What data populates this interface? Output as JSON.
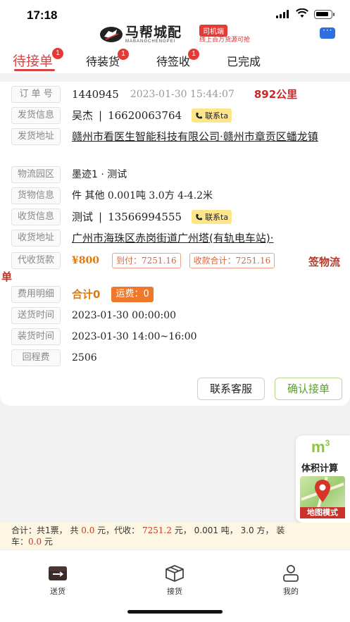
{
  "status_bar": {
    "time": "17:18"
  },
  "header": {
    "logo_text": "马帮城配",
    "logo_sub": "MABANGCHENGPEI",
    "driver_tag": "司机端",
    "driver_slogan": "线上百万货源可抢",
    "chat_icon": "chat-bubble-icon"
  },
  "tabs": [
    {
      "label": "待接单",
      "badge": "1",
      "active": true
    },
    {
      "label": "待装货",
      "badge": "1",
      "active": false
    },
    {
      "label": "待签收",
      "badge": "1",
      "active": false
    },
    {
      "label": "已完成",
      "badge": "",
      "active": false
    }
  ],
  "order": {
    "order_no_label": "订 单 号",
    "order_no": "1440945",
    "order_time": "2023-01-30 15:44:07",
    "distance": "892公里",
    "sender_label": "发货信息",
    "sender_name": "吴杰",
    "sender_phone": "16620063764",
    "contact_label": "联系ta",
    "sender_addr_label": "发货地址",
    "sender_addr": "赣州市看医生智能科技有限公司·赣州市章贡区蟠龙镇",
    "park_label": "物流园区",
    "park": "墨迹1 · 测试",
    "goods_label": "货物信息",
    "goods": "件 其他 0.001吨 3.0方 4-4.2米",
    "receiver_label": "收货信息",
    "receiver_name": "测试",
    "receiver_phone": "13566994555",
    "receiver_addr_label": "收货地址",
    "receiver_addr": "广州市海珠区赤岗街道广州塔(有轨电车站)·",
    "cod_label": "代收货款",
    "cod_amount": "¥800",
    "to_pay_label": "到付：",
    "to_pay": "7251.16",
    "collect_total_label": "收款合计：",
    "collect_total": "7251.16",
    "sign_label_line1": "签物流",
    "sign_label_line2": "单",
    "fee_label": "费用明细",
    "fee_total": "合计0",
    "freight": "运费：0",
    "delivery_time_label": "送货时间",
    "delivery_time": "2023-01-30 00:00:00",
    "loading_time_label": "装货时间",
    "loading_time": "2023-01-30 14:00~16:00",
    "return_fee_label": "回程费",
    "return_fee": "2506"
  },
  "actions": {
    "contact_service": "联系客服",
    "confirm_order": "确认接单"
  },
  "float_panel": {
    "m3": "m",
    "m3_sup": "3",
    "volume_calc": "体积计算",
    "map_mode": "地图模式"
  },
  "summary": {
    "prefix": "合计：共1票，  共 ",
    "amount": "0.0",
    "mid1": " 元，代收：  ",
    "cod": "7251.2",
    "mid2": " 元，  0.001 吨，  3.0 方，  装",
    "line2_prefix": "车：",
    "loading": "0.0",
    "line2_suffix": " 元"
  },
  "bottom_nav": [
    {
      "label": "送货",
      "icon": "delivery-box-icon"
    },
    {
      "label": "接货",
      "icon": "package-icon"
    },
    {
      "label": "我的",
      "icon": "user-icon"
    }
  ],
  "colors": {
    "accent_red": "#d64545",
    "orange": "#e07a10",
    "green": "#5aa22c",
    "contact_yellow": "#fde58a"
  }
}
